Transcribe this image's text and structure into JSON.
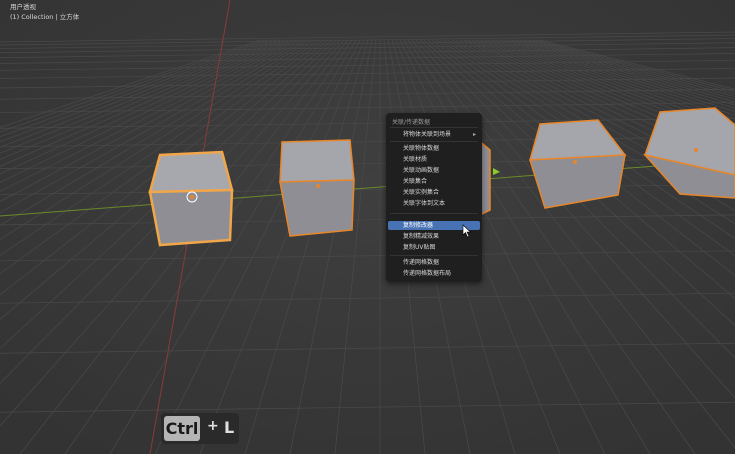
{
  "viewport": {
    "view_name": "用户透视",
    "collection_label": "(1) Collection | 立方体"
  },
  "menu": {
    "title": "关联/传递数据",
    "items": [
      {
        "label": "将物体关联到场景",
        "submenu": "▸"
      },
      {
        "label": "关联物体数据"
      },
      {
        "label": "关联材质"
      },
      {
        "label": "关联动画数据"
      },
      {
        "label": "关联集合"
      },
      {
        "label": "关联实例集合"
      },
      {
        "label": "关联字体到文本"
      },
      {
        "label": "复制修改器",
        "highlighted": true
      },
      {
        "label": "复制精减效果"
      },
      {
        "label": "复制UV贴图"
      },
      {
        "label": "传递网格数据"
      },
      {
        "label": "传递网格数据布局"
      }
    ]
  },
  "shortcut": {
    "ctrl_label": "Ctrl",
    "plus_label": "+",
    "key_label": "L"
  },
  "colors": {
    "background": "#3a3a3a",
    "grid": "#484848",
    "x_axis": "#8a3a3a",
    "y_axis": "#6a8a2a",
    "selection_outline": "#e8862a",
    "active_outline": "#f2a64a",
    "menu_highlight": "#4772b3"
  }
}
